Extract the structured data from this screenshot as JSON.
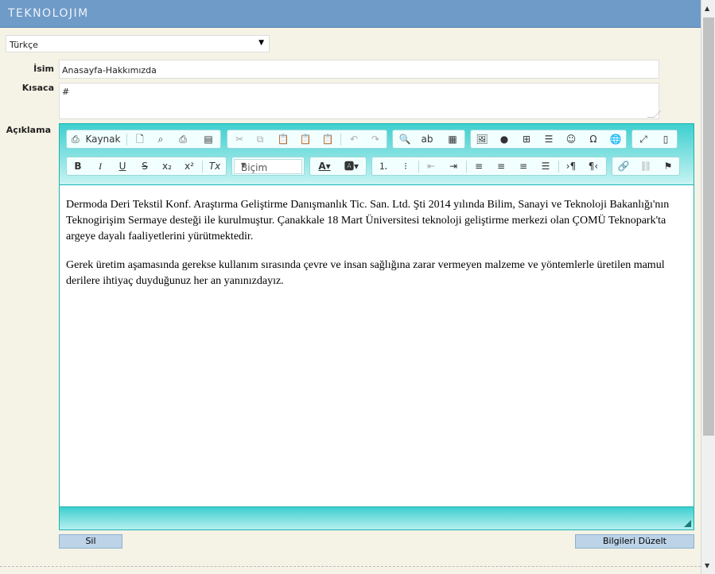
{
  "app": {
    "brand": "TEKNOLOJIM"
  },
  "language": {
    "selected": "Türkçe"
  },
  "form": {
    "isim_label": "İsim",
    "isim_value": "Anasayfa-Hakkımızda",
    "kisaca_label": "Kısaca",
    "kisaca_value": "#",
    "aciklama_label": "Açıklama"
  },
  "editor": {
    "source_label": "Kaynak",
    "format_label": "Biçim",
    "paragraphs": [
      "Dermoda Deri Tekstil Konf. Araştırma Geliştirme Danışmanlık Tic. San. Ltd. Şti 2014 yılında Bilim, Sanayi ve Teknoloji Bakanlığı'nın Teknogirişim Sermaye desteği ile kurulmuştur. Çanakkale 18 Mart Üniversitesi teknoloji geliştirme merkezi olan ÇOMÜ Teknopark'ta argeye dayalı faaliyetlerini yürütmektedir.",
      "Gerek üretim aşamasında gerekse kullanım sırasında çevre ve insan sağlığına zarar vermeyen malzeme ve yöntemlerle üretilen mamul derilere ihtiyaç duyduğunuz her an yanınızdayız."
    ]
  },
  "actions": {
    "delete_label": "Sil",
    "save_label": "Bilgileri Düzelt"
  },
  "colors": {
    "header": "#6f9bc8",
    "editor_accent": "#1ab3b3",
    "background": "#f5f3e6",
    "button": "#bcd3e8"
  },
  "icons": [
    "source-icon",
    "new-page-icon",
    "preview-icon",
    "print-icon",
    "templates-icon",
    "cut-icon",
    "copy-icon",
    "paste-icon",
    "paste-text-icon",
    "paste-word-icon",
    "undo-icon",
    "redo-icon",
    "find-icon",
    "replace-icon",
    "select-all-icon",
    "image-icon",
    "flash-icon",
    "table-icon",
    "horizontal-line-icon",
    "smiley-icon",
    "special-char-icon",
    "iframe-icon",
    "maximize-icon",
    "show-blocks-icon",
    "bold-icon",
    "italic-icon",
    "underline-icon",
    "strike-icon",
    "subscript-icon",
    "superscript-icon",
    "remove-format-icon",
    "text-color-icon",
    "bg-color-icon",
    "numbered-list-icon",
    "bulleted-list-icon",
    "outdent-icon",
    "indent-icon",
    "align-left-icon",
    "align-center-icon",
    "align-right-icon",
    "justify-icon",
    "ltr-icon",
    "rtl-icon",
    "link-icon",
    "unlink-icon",
    "anchor-icon"
  ]
}
